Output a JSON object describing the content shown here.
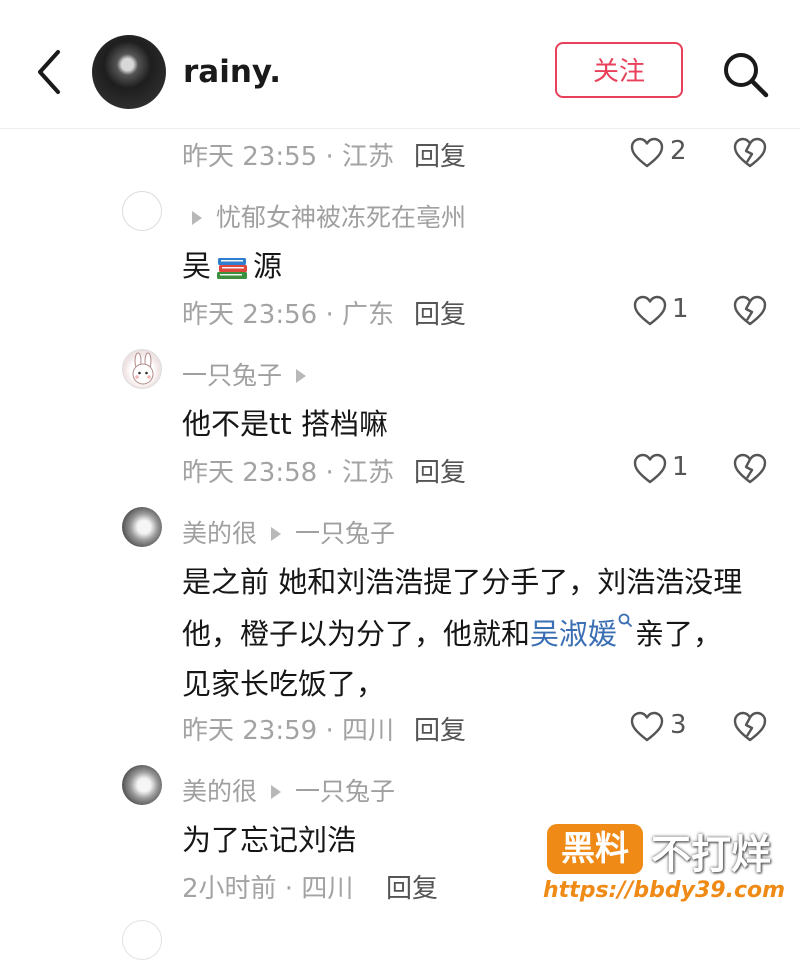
{
  "header": {
    "username": "rainy.",
    "follow_label": "关注"
  },
  "comments": [
    {
      "meta": "昨天 23:55 · 江苏",
      "reply": "回复",
      "likes": "2"
    },
    {
      "user": "",
      "reply_to": "忧郁女神被冻死在亳州",
      "text_before": "吴",
      "text_after": "源",
      "meta": "昨天 23:56 · 广东",
      "reply": "回复",
      "likes": "1"
    },
    {
      "user": "一只兔子",
      "text": "他不是tt 搭档嘛",
      "meta": "昨天 23:58 · 江苏",
      "reply": "回复",
      "likes": "1"
    },
    {
      "user": "美的很",
      "reply_to": "一只兔子",
      "line1": "是之前 她和刘浩浩提了分手了，刘浩浩没理",
      "line2_before": "他，橙子以为分了，他就和",
      "line2_link": "吴淑媛",
      "line2_after": "亲了，",
      "line3": "见家长吃饭了，",
      "meta": "昨天 23:59 · 四川",
      "reply": "回复",
      "likes": "3"
    },
    {
      "user": "美的很",
      "reply_to": "一只兔子",
      "text": "为了忘记刘浩",
      "meta": "2小时前 · 四川",
      "reply": "回复"
    }
  ],
  "watermark": {
    "badge": "黑料",
    "title": "不打烊",
    "url": "https://bbdy39.com"
  },
  "icons": {
    "back": "chevron-left-icon",
    "search": "search-icon",
    "like": "heart-outline-icon",
    "dislike": "broken-heart-icon",
    "books": "books-emoji-icon",
    "search_link": "search-small-icon"
  }
}
